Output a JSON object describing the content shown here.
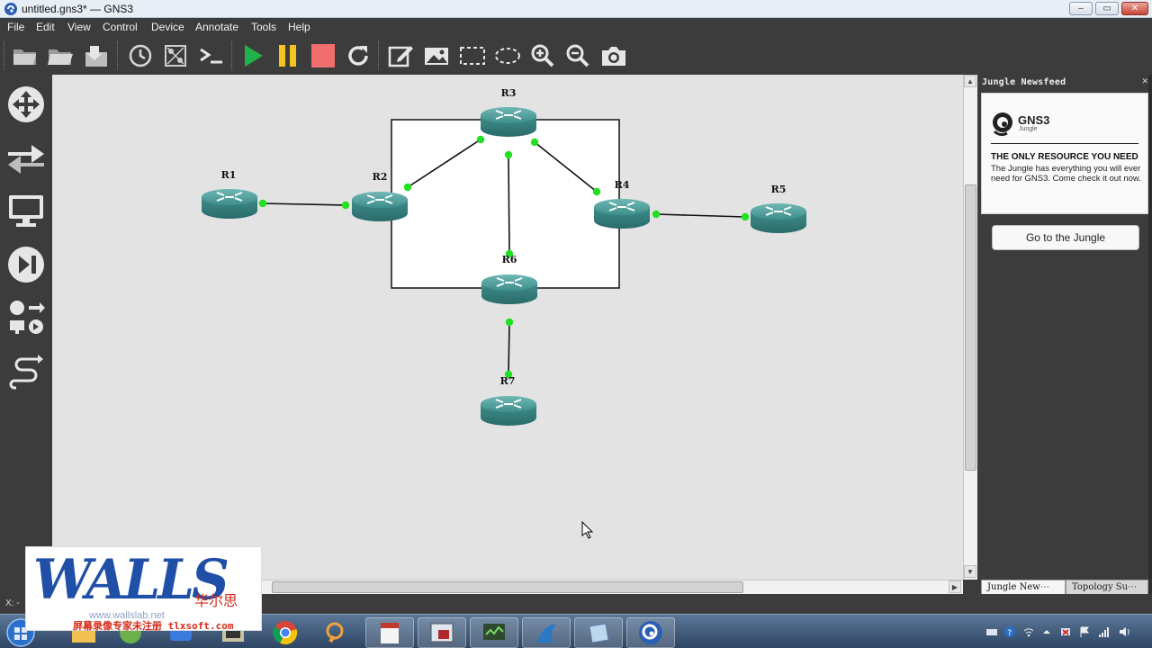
{
  "window": {
    "title": "untitled.gns3* — GNS3",
    "controls": {
      "minimize": "–",
      "maximize": "▭",
      "close": "✕"
    }
  },
  "menu": [
    "File",
    "Edit",
    "View",
    "Control",
    "Device",
    "Annotate",
    "Tools",
    "Help"
  ],
  "toolbar": {
    "buttons": [
      "open-folder-icon",
      "open-project-icon",
      "save-icon",
      "snapshot-clock-icon",
      "show-interface-labels-icon",
      "console-icon",
      "start-all-icon",
      "suspend-all-icon",
      "stop-all-icon",
      "reload-all-icon",
      "add-note-icon",
      "insert-picture-icon",
      "draw-rectangle-icon",
      "draw-ellipse-icon",
      "zoom-in-icon",
      "zoom-out-icon",
      "screenshot-icon"
    ],
    "colors": {
      "start": "#22b24c",
      "suspend": "#f2c521",
      "stop": "#f26d6d"
    }
  },
  "left_dock": [
    "browse-routers-icon",
    "browse-switches-icon",
    "browse-end-devices-icon",
    "browse-security-devices-icon",
    "browse-all-devices-icon",
    "add-link-icon"
  ],
  "topology": {
    "nodes": [
      {
        "id": "R1",
        "label": "R1"
      },
      {
        "id": "R2",
        "label": "R2"
      },
      {
        "id": "R3",
        "label": "R3"
      },
      {
        "id": "R4",
        "label": "R4"
      },
      {
        "id": "R5",
        "label": "R5"
      },
      {
        "id": "R6",
        "label": "R6"
      },
      {
        "id": "R7",
        "label": "R7"
      }
    ],
    "links": [
      [
        "R1",
        "R2"
      ],
      [
        "R2",
        "R3"
      ],
      [
        "R3",
        "R4"
      ],
      [
        "R3",
        "R6"
      ],
      [
        "R4",
        "R5"
      ],
      [
        "R6",
        "R7"
      ]
    ],
    "link_status_color": "#22e022",
    "router_color": "#3e8e8c"
  },
  "right_dock": {
    "title": "Jungle Newsfeed",
    "close": "✕",
    "card": {
      "logo_text": "GNS3",
      "logo_sub": "Jungle",
      "heading": "THE ONLY RESOURCE YOU NEED",
      "body": "The Jungle has everything you will ever need for GNS3. Come check it out now."
    },
    "button": "Go to the Jungle",
    "tabs": [
      "Jungle New⋯",
      "Topology Su⋯"
    ]
  },
  "status": {
    "text": "X: -"
  },
  "watermark": {
    "brand": "WALLS",
    "cn": "华尔思",
    "url": "www.wallslab.net",
    "reg": "屏幕录像专家未注册 tlxsoft.com"
  },
  "taskbar": {
    "apps": [
      "start-orb-icon",
      "file-explorer-icon",
      "browser-icon",
      "mail-icon",
      "terminal-icon",
      "chrome-icon",
      "search-tool-icon",
      "notepad-icon",
      "window-manager-icon",
      "network-monitor-icon",
      "wireshark-icon",
      "editor-icon",
      "gns3-icon"
    ],
    "tray": [
      "keyboard-icon",
      "help-icon",
      "wifi-icon",
      "show-hidden-icon",
      "network-icon",
      "flag-icon",
      "signal-icon",
      "volume-icon"
    ]
  }
}
